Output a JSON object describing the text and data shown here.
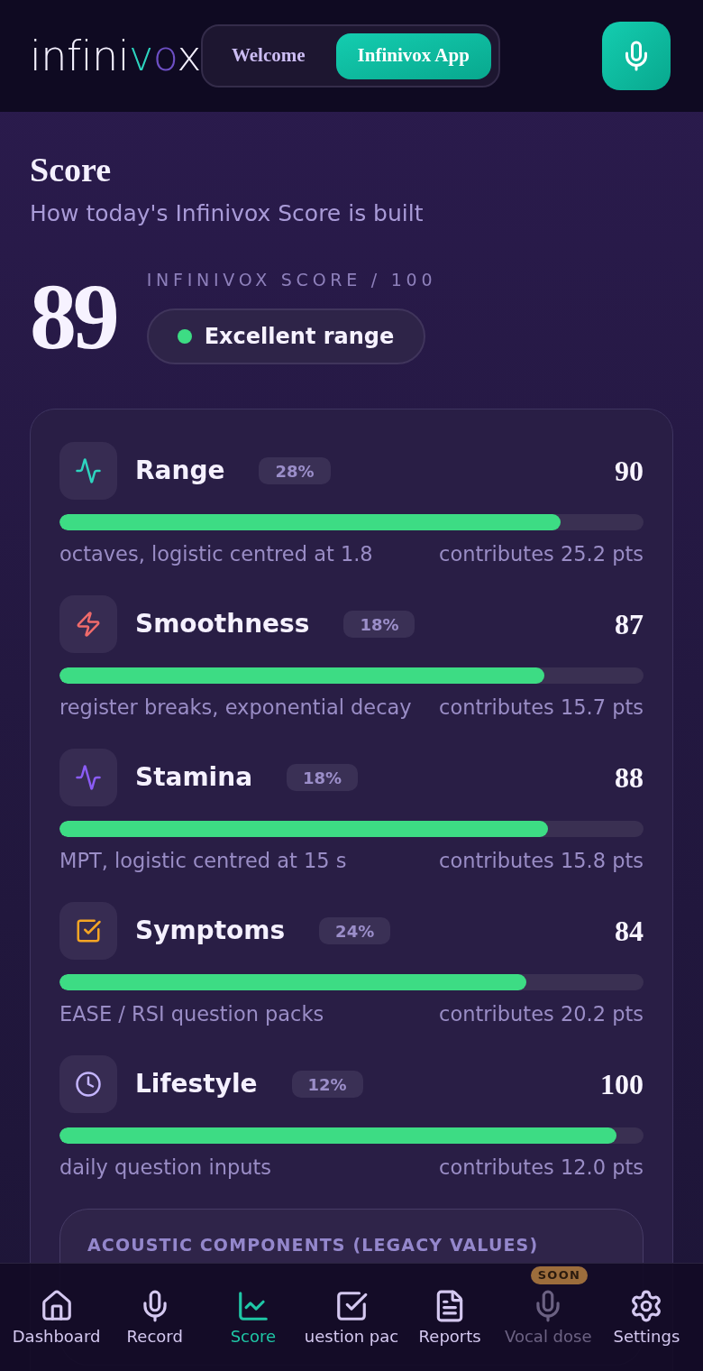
{
  "header": {
    "brand": "infinivox",
    "tabs": [
      {
        "label": "Welcome",
        "selected": false
      },
      {
        "label": "Infinivox App",
        "selected": true
      }
    ]
  },
  "page": {
    "title": "Score",
    "subtitle": "How today's Infinivox Score is built"
  },
  "score": {
    "value": "89",
    "caption": "INFINIVOX SCORE / 100",
    "status": {
      "label": "Excellent range",
      "color": "#3ddc84"
    }
  },
  "metrics": [
    {
      "name": "Range",
      "weight": "28%",
      "score": "90",
      "level": 0.858,
      "description": "octaves, logistic centred at 1.8",
      "contribution": "contributes 25.2 pts",
      "color": "#2dd4bf"
    },
    {
      "name": "Smoothness",
      "weight": "18%",
      "score": "87",
      "level": 0.83,
      "description": "register breaks, exponential decay",
      "contribution": "contributes 15.7 pts",
      "color": "#f06b6b"
    },
    {
      "name": "Stamina",
      "weight": "18%",
      "score": "88",
      "level": 0.836,
      "description": "MPT, logistic centred at 15 s",
      "contribution": "contributes 15.8 pts",
      "color": "#8b5cf6"
    },
    {
      "name": "Symptoms",
      "weight": "24%",
      "score": "84",
      "level": 0.8,
      "description": "EASE / RSI question packs",
      "contribution": "contributes 20.2 pts",
      "color": "#f5a524"
    },
    {
      "name": "Lifestyle",
      "weight": "12%",
      "score": "100",
      "level": 0.954,
      "description": "daily question inputs",
      "contribution": "contributes 12.0 pts",
      "color": "#c4b5fd"
    }
  ],
  "legacy_card": {
    "heading": "ACOUSTIC COMPONENTS (LEGACY VALUES)"
  },
  "bottom_nav": [
    {
      "label": "Dashboard",
      "selected": false,
      "disabled": false
    },
    {
      "label": "Record",
      "selected": false,
      "disabled": false
    },
    {
      "label": "Score",
      "selected": true,
      "disabled": false
    },
    {
      "label": "uestion pac",
      "selected": false,
      "disabled": false
    },
    {
      "label": "Reports",
      "selected": false,
      "disabled": false
    },
    {
      "label": "Vocal dose",
      "selected": false,
      "disabled": true,
      "badge": "SOON"
    },
    {
      "label": "Settings",
      "selected": false,
      "disabled": false
    }
  ]
}
